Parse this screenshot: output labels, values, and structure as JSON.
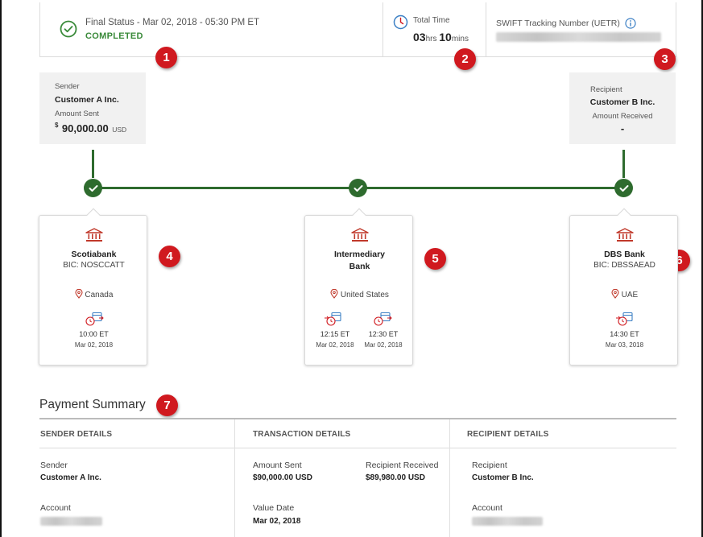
{
  "status": {
    "final_text": "Final Status - Mar 02, 2018 - 05:30 PM ET",
    "state": "COMPLETED",
    "total_time_label": "Total Time",
    "hours": "03",
    "hours_unit": "hrs",
    "minutes": "10",
    "minutes_unit": "mins",
    "swift_label": "SWIFT Tracking Number (UETR)"
  },
  "markers": [
    "1",
    "2",
    "3",
    "4",
    "5",
    "6",
    "7"
  ],
  "sender": {
    "label": "Sender",
    "name": "Customer A Inc.",
    "amount_label": "Amount Sent",
    "currency_symbol": "$",
    "amount": "90,000.00",
    "currency": "USD"
  },
  "recipient": {
    "label": "Recipient",
    "name": "Customer B Inc.",
    "amount_label": "Amount Received",
    "amount": "-"
  },
  "banks": [
    {
      "name": "Scotiabank",
      "bic": "BIC: NOSCCATT",
      "location": "Canada",
      "events": [
        {
          "time": "10:00 ET",
          "date": "Mar 02, 2018"
        }
      ]
    },
    {
      "name_line1": "Intermediary",
      "name_line2": "Bank",
      "location": "United States",
      "events": [
        {
          "time": "12:15 ET",
          "date": "Mar 02, 2018"
        },
        {
          "time": "12:30 ET",
          "date": "Mar 02, 2018"
        }
      ]
    },
    {
      "name": "DBS Bank",
      "bic": "BIC: DBSSAEAD",
      "location": "UAE",
      "events": [
        {
          "time": "14:30 ET",
          "date": "Mar 03, 2018"
        }
      ]
    }
  ],
  "summary": {
    "title": "Payment Summary",
    "sender_details": {
      "heading": "SENDER DETAILS",
      "sender_label": "Sender",
      "sender_value": "Customer A Inc.",
      "account_label": "Account"
    },
    "transaction_details": {
      "heading": "TRANSACTION DETAILS",
      "amount_sent_label": "Amount Sent",
      "amount_sent_value": "$90,000.00 USD",
      "recipient_received_label": "Recipient Received",
      "recipient_received_value": "$89,980.00 USD",
      "value_date_label": "Value Date",
      "value_date_value": "Mar 02, 2018"
    },
    "recipient_details": {
      "heading": "RECIPIENT DETAILS",
      "recipient_label": "Recipient",
      "recipient_value": "Customer B Inc.",
      "account_label": "Account"
    }
  },
  "colors": {
    "success": "#3a8a3a",
    "timeline": "#2e6b2e",
    "marker": "#d0191f",
    "bank_icon": "#c0392b",
    "time_icon": "#3b7fc4"
  },
  "icons": [
    "check-circle-icon",
    "clock-icon",
    "info-icon",
    "bank-icon",
    "location-pin-icon",
    "calendar-clock-icon",
    "check-icon"
  ]
}
